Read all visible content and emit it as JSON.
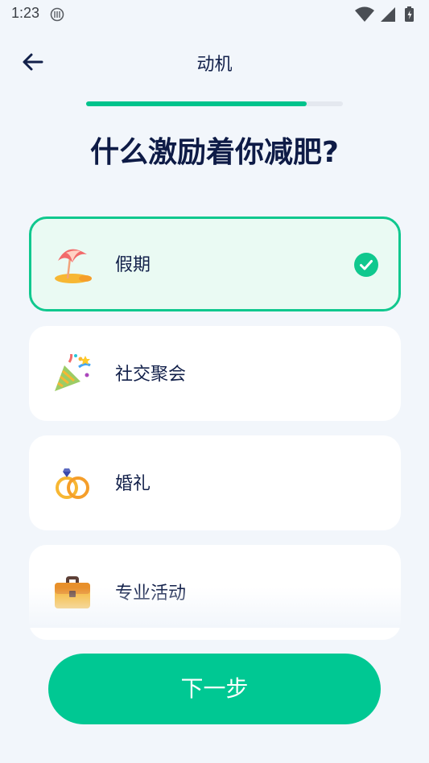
{
  "status_bar": {
    "time": "1:23",
    "icons": [
      "notification-icon",
      "wifi-icon",
      "signal-icon",
      "battery-icon"
    ]
  },
  "header": {
    "back_icon": "arrow-left-icon",
    "title": "动机"
  },
  "progress": {
    "fraction": 0.86
  },
  "question": "什么激励着你减肥?",
  "options": [
    {
      "label": "假期",
      "icon": "beach-umbrella-icon",
      "selected": true
    },
    {
      "label": "社交聚会",
      "icon": "party-popper-icon",
      "selected": false
    },
    {
      "label": "婚礼",
      "icon": "wedding-rings-icon",
      "selected": false
    },
    {
      "label": "专业活动",
      "icon": "briefcase-icon",
      "selected": false
    }
  ],
  "next_button": {
    "label": "下一步"
  },
  "colors": {
    "accent": "#00c893",
    "selected_bg": "#eafaf3",
    "text": "#12204a",
    "background": "#f2f6fb"
  }
}
